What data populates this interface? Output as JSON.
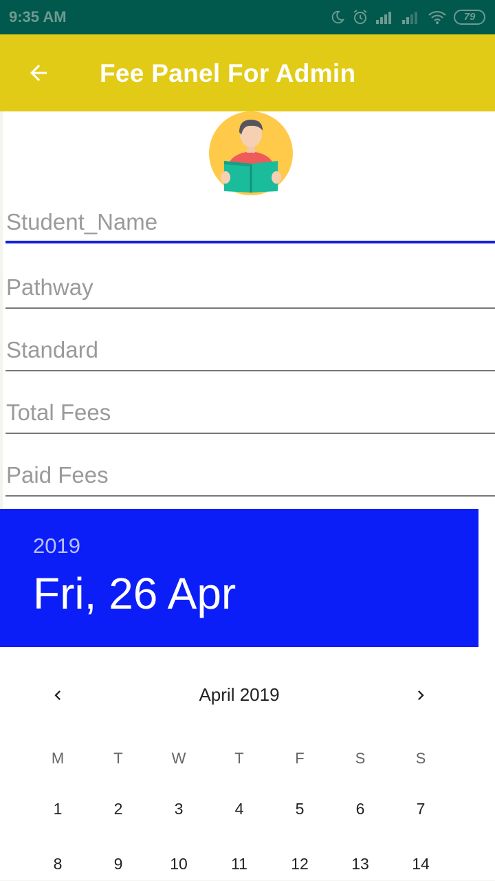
{
  "status_bar": {
    "time": "9:35 AM",
    "battery": "79",
    "icons": [
      "moon-icon",
      "alarm-icon",
      "signal-icon",
      "signal-icon",
      "wifi-icon",
      "battery-icon"
    ]
  },
  "app_bar": {
    "back_icon": "arrow-left-icon",
    "title": "Fee Panel For Admin",
    "color": "#e2cb16"
  },
  "avatar": {
    "icon": "student-reading-icon"
  },
  "form": {
    "fields": [
      {
        "placeholder": "Student_Name",
        "value": "",
        "focused": true
      },
      {
        "placeholder": "Pathway",
        "value": ""
      },
      {
        "placeholder": "Standard",
        "value": ""
      },
      {
        "placeholder": "Total Fees",
        "value": ""
      },
      {
        "placeholder": "Paid Fees",
        "value": ""
      }
    ],
    "accent": "#1320d8"
  },
  "date_picker": {
    "year": "2019",
    "selected_date": "Fri, 26 Apr",
    "header_color": "#0c1ef7",
    "month_label": "April 2019",
    "prev_icon": "chevron-left-icon",
    "next_icon": "chevron-right-icon",
    "weekdays": [
      "M",
      "T",
      "W",
      "T",
      "F",
      "S",
      "S"
    ],
    "days": [
      "1",
      "2",
      "3",
      "4",
      "5",
      "6",
      "7",
      "8",
      "9",
      "10",
      "11",
      "12",
      "13",
      "14"
    ]
  }
}
